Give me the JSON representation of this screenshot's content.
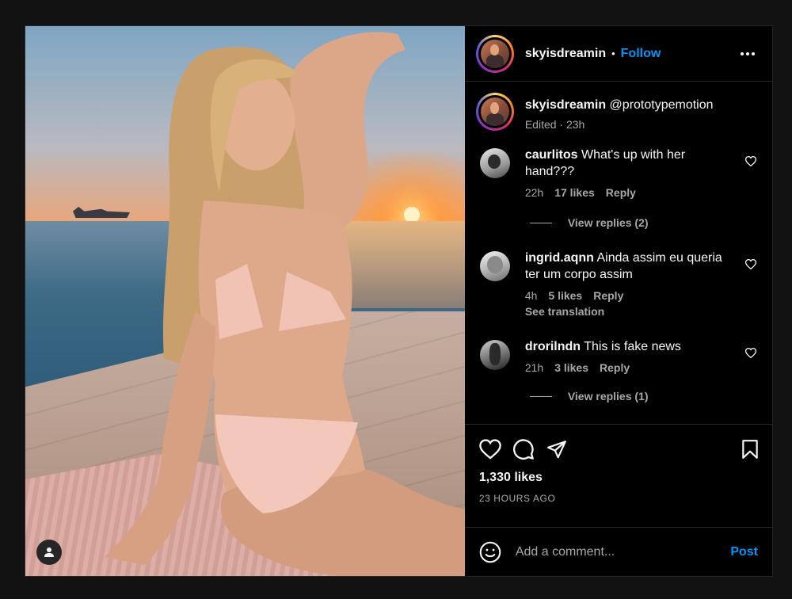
{
  "post": {
    "author": "skyisdreamin",
    "follow_label": "Follow",
    "separator": "•"
  },
  "caption": {
    "author": "skyisdreamin",
    "text": " @prototypemotion",
    "edited": "Edited",
    "time": "23h"
  },
  "comments": [
    {
      "user": "caurlitos",
      "text": " What's up with her hand???",
      "time": "22h",
      "likes": "17 likes",
      "reply": "Reply",
      "view_replies": "View replies (2)"
    },
    {
      "user": "ingrid.aqnn",
      "text": " Ainda assim eu queria ter um corpo assim",
      "time": "4h",
      "likes": "5 likes",
      "reply": "Reply",
      "see_translation": "See translation"
    },
    {
      "user": "drorilndn",
      "text": " This is fake news",
      "time": "21h",
      "likes": "3 likes",
      "reply": "Reply",
      "view_replies": "View replies (1)"
    }
  ],
  "engagement": {
    "likes": "1,330 likes",
    "timestamp": "23 HOURS AGO"
  },
  "composer": {
    "placeholder": "Add a comment...",
    "post_label": "Post"
  },
  "icons": {
    "like": "heart-icon",
    "comment": "comment-icon",
    "share": "share-icon",
    "save": "bookmark-icon",
    "emoji": "emoji-icon",
    "more": "more-icon",
    "tagged": "user-icon"
  },
  "colors": {
    "accent": "#0095f6",
    "background": "#000000",
    "muted": "#a8a8a8"
  }
}
